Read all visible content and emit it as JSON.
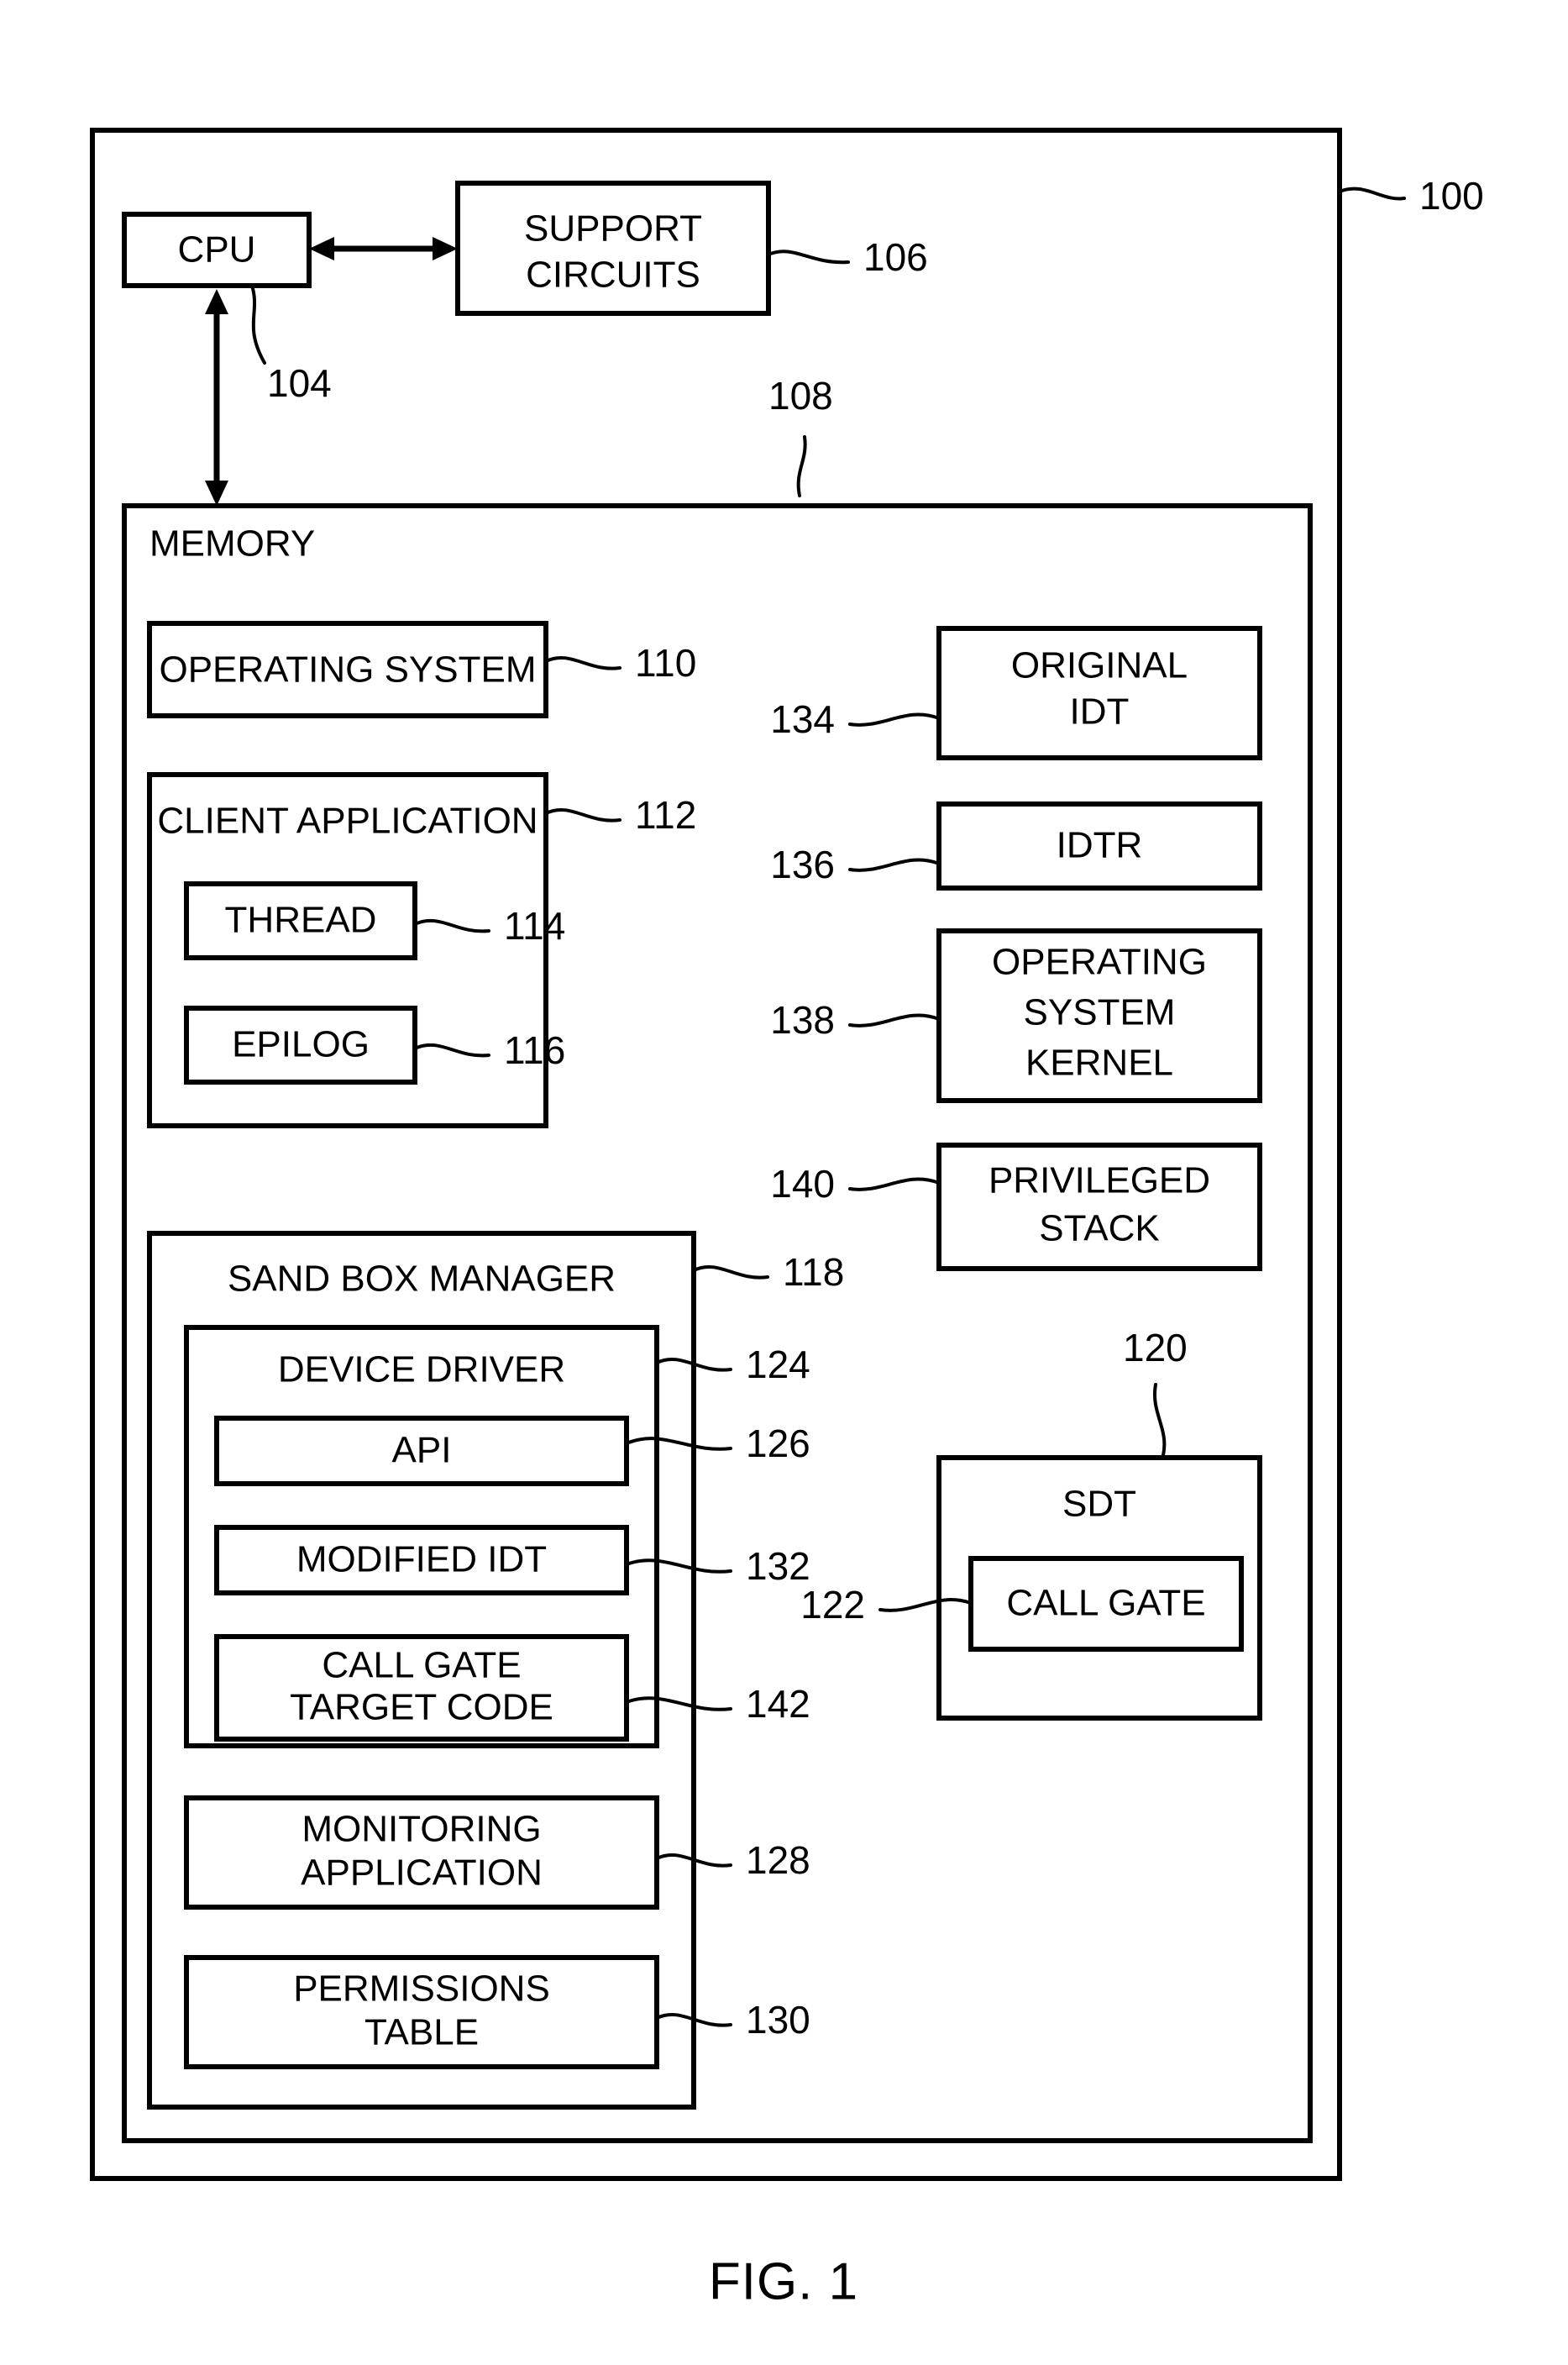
{
  "figure": {
    "caption": "FIG. 1",
    "system_ref": "100"
  },
  "hardware": {
    "cpu": {
      "label": "CPU",
      "ref": "104"
    },
    "support_circuits": {
      "label": "SUPPORT CIRCUITS",
      "line1": "SUPPORT",
      "line2": "CIRCUITS",
      "ref": "106"
    }
  },
  "memory": {
    "label": "MEMORY",
    "ref": "108",
    "left_column": {
      "operating_system": {
        "label": "OPERATING SYSTEM",
        "ref": "110"
      },
      "client_application": {
        "label": "CLIENT APPLICATION",
        "ref": "112",
        "children": [
          {
            "label": "THREAD",
            "ref": "114"
          },
          {
            "label": "EPILOG",
            "ref": "116"
          }
        ]
      },
      "sand_box_manager": {
        "label": "SAND BOX MANAGER",
        "ref": "118",
        "device_driver": {
          "label": "DEVICE DRIVER",
          "ref": "124",
          "children": [
            {
              "label": "API",
              "ref": "126"
            },
            {
              "label": "MODIFIED IDT",
              "ref": "132"
            },
            {
              "label": "CALL GATE TARGET CODE",
              "line1": "CALL GATE",
              "line2": "TARGET CODE",
              "ref": "142"
            }
          ]
        },
        "monitoring_application": {
          "label": "MONITORING APPLICATION",
          "line1": "MONITORING",
          "line2": "APPLICATION",
          "ref": "128"
        },
        "permissions_table": {
          "label": "PERMISSIONS TABLE",
          "line1": "PERMISSIONS",
          "line2": "TABLE",
          "ref": "130"
        }
      }
    },
    "right_column": {
      "original_idt": {
        "label": "ORIGINAL IDT",
        "line1": "ORIGINAL",
        "line2": "IDT",
        "ref": "134"
      },
      "idtr": {
        "label": "IDTR",
        "ref": "136"
      },
      "operating_system_kernel": {
        "label": "OPERATING SYSTEM KERNEL",
        "line1": "OPERATING",
        "line2": "SYSTEM",
        "line3": "KERNEL",
        "ref": "138"
      },
      "privileged_stack": {
        "label": "PRIVILEGED STACK",
        "line1": "PRIVILEGED",
        "line2": "STACK",
        "ref": "140"
      },
      "sdt": {
        "label": "SDT",
        "ref": "120",
        "call_gate": {
          "label": "CALL GATE",
          "ref": "122"
        }
      }
    }
  },
  "colors": {
    "stroke": "#000000",
    "background": "#ffffff"
  }
}
